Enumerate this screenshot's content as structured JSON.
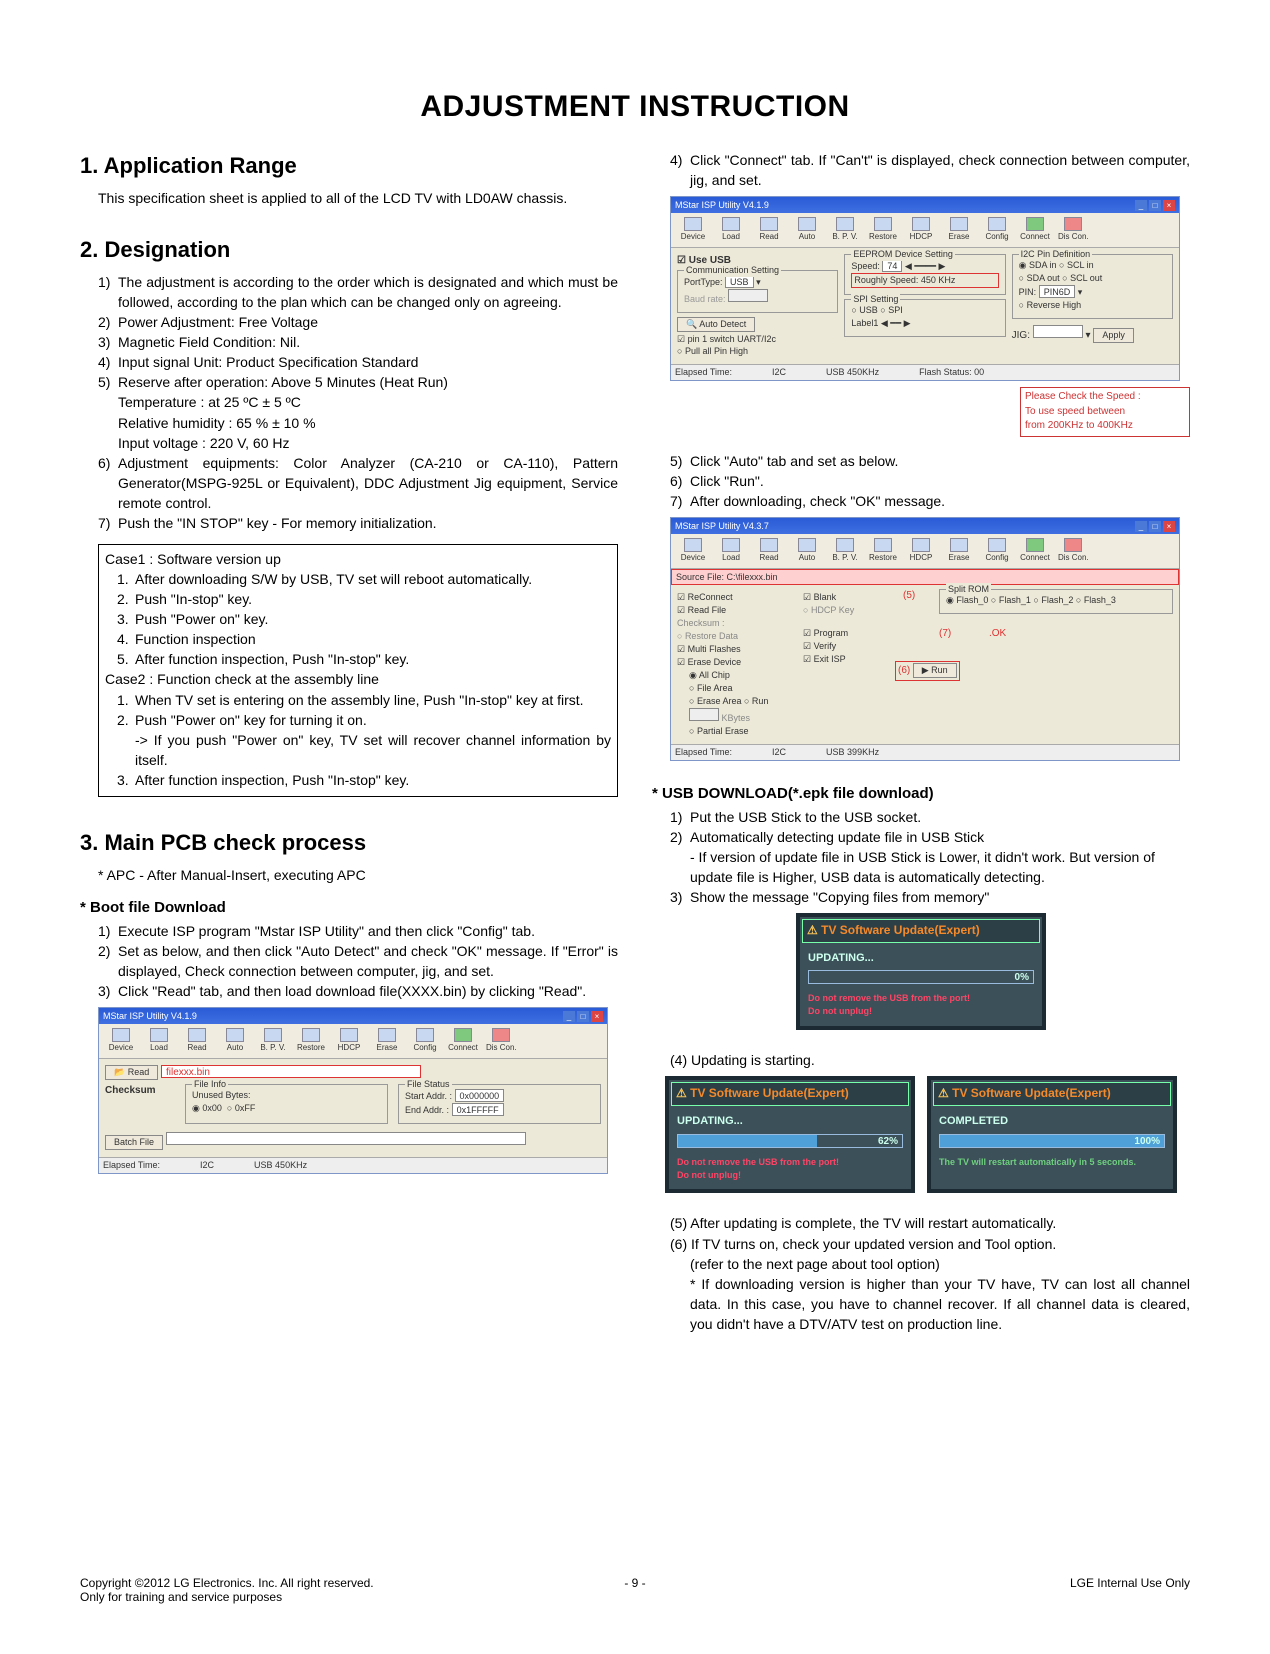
{
  "title": "ADJUSTMENT INSTRUCTION",
  "s1": {
    "heading": "1. Application Range",
    "body": "This specification sheet is applied to all of the LCD TV with LD0AW chassis."
  },
  "s2": {
    "heading": "2. Designation",
    "i1": "The adjustment is according to the order which is designated and which must be followed, according to the plan which can be changed only on agreeing.",
    "i2": "Power Adjustment: Free Voltage",
    "i3": "Magnetic Field Condition: Nil.",
    "i4": "Input signal Unit: Product Specification Standard",
    "i5": "Reserve after operation: Above 5 Minutes (Heat Run)",
    "i5a": "Temperature : at 25 ºC ± 5 ºC",
    "i5b": "Relative humidity : 65 % ± 10 %",
    "i5c": "Input voltage : 220 V, 60 Hz",
    "i6": "Adjustment equipments: Color Analyzer (CA-210 or CA-110), Pattern Generator(MSPG-925L or Equivalent), DDC Adjustment Jig equipment, Service remote control.",
    "i7": "Push the \"IN STOP\" key - For memory initialization.",
    "case1h": "Case1 : Software version up",
    "c1_1": "After downloading S/W by USB, TV set will reboot automatically.",
    "c1_2": "Push \"In-stop\" key.",
    "c1_3": "Push \"Power on\" key.",
    "c1_4": "Function inspection",
    "c1_5": "After function inspection, Push \"In-stop\" key.",
    "case2h": "Case2 : Function check at the assembly line",
    "c2_1": "When TV set is entering on the assembly line, Push \"In-stop\" key at first.",
    "c2_2": "Push \"Power on\" key for turning it on.",
    "c2_2a": "-> If you push \"Power on\" key, TV set will recover channel information by itself.",
    "c2_3": "After function inspection, Push \"In-stop\" key."
  },
  "s3": {
    "heading": "3. Main PCB check process",
    "apc": "* APC - After Manual-Insert, executing APC",
    "boot_h": "* Boot file Download",
    "b1": "Execute ISP program \"Mstar ISP Utility\" and then click \"Config\" tab.",
    "b2": "Set as below, and then click \"Auto Detect\" and check \"OK\" message. If \"Error\" is displayed, Check connection between computer, jig, and set.",
    "b3": "Click \"Read\" tab, and then load download file(XXXX.bin) by clicking \"Read\"."
  },
  "right": {
    "r4": "Click \"Connect\" tab. If \"Can't\" is displayed, check connection between computer, jig, and set.",
    "r5": "Click \"Auto\" tab and set as below.",
    "r6": "Click \"Run\".",
    "r7": "After downloading, check \"OK\" message.",
    "usb_h": "* USB DOWNLOAD(*.epk file download)",
    "u1": "Put the USB Stick to the USB socket.",
    "u2": "Automatically detecting update file in USB Stick",
    "u2a": "- If version of update file in USB Stick is Lower, it didn't work. But version of update file is Higher, USB data is automatically detecting.",
    "u3": "Show the message \"Copying files from memory\"",
    "u4": "(4) Updating is starting.",
    "u5": "(5) After updating is complete, the TV will restart automatically.",
    "u6": "(6) If TV turns on, check your updated version and Tool option.",
    "u6a": "(refer to the next page about tool option)",
    "u6b": "* If downloading version is higher than your TV have, TV can lost all channel data. In this case, you have to channel recover. If all channel data is cleared, you didn't have a DTV/ATV test on production line."
  },
  "shotA": {
    "title": "MStar ISP Utility V4.1.9",
    "tbtns": [
      "Device",
      "Load",
      "Read",
      "Auto",
      "B. P. V.",
      "Restore",
      "HDCP",
      "Erase",
      "Config",
      "Connect",
      "Dis Con."
    ],
    "read_btn": "Read",
    "filelabel": "filexxx.bin",
    "checksum": "Checksum",
    "file_info": "File Info",
    "unused": "Unused Bytes:",
    "opt00": "0x00",
    "optff": "0xFF",
    "file_status": "File Status",
    "startaddr": "Start Addr. :",
    "startv": "0x000000",
    "endaddr": "End Addr. :",
    "endv": "0x1FFFFF",
    "batch": "Batch File",
    "elapsed": "Elapsed Time:",
    "i2c": "I2C",
    "usb": "USB  450KHz"
  },
  "shotB": {
    "title": "MStar ISP Utility V4.1.9",
    "useusb": "Use USB",
    "comm": "Communication Setting",
    "porttype": "PortType:",
    "porttype_v": "USB",
    "baud": "Baud rate:",
    "autodetect": "Auto Detect",
    "pin1": "pin 1 switch UART/I2c",
    "pullpin": "Pull all Pin High",
    "eeprom": "EEPROM Device Setting",
    "speed": "Speed:",
    "speed_v": "74",
    "roughly": "Roughly Speed: 450 KHz",
    "spi": "SPI Setting",
    "usb2": "USB",
    "spi2": "SPI",
    "label1": "Label1",
    "i2cpin": "I2C Pin Definition",
    "sdain": "SDA in",
    "sclin": "SCL in",
    "sdaout": "SDA out",
    "sclout": "SCL out",
    "pin": "PIN:",
    "pin_v": "PIN6D",
    "revhigh": "Reverse High",
    "jig": "JIG:",
    "apply": "Apply",
    "elapsed": "Elapsed Time:",
    "i2c": "I2C",
    "usbstat": "USB  450KHz",
    "flashstat": "Flash Status: 00",
    "warn1": "Please Check the Speed :",
    "warn2": "To use speed between",
    "warn3": "from 200KHz   to 400KHz"
  },
  "shotC": {
    "title": "MStar ISP Utility V4.3.7",
    "tbtns": [
      "Device",
      "Load",
      "Read",
      "Auto",
      "B. P. V.",
      "Restore",
      "HDCP",
      "Erase",
      "Config",
      "Connect",
      "Dis Con."
    ],
    "src": "Source File: C:\\filexxx.bin",
    "reconnect": "ReConnect",
    "readfile": "Read File",
    "checksum": "Checksum :",
    "restoredata": "Restore Data",
    "multi": "Multi Flashes",
    "erasedev": "Erase Device",
    "allchip": "All Chip",
    "filearea": "File Area",
    "erasearea": "Erase Area",
    "partial": "Partial Erase",
    "blank": "Blank",
    "hdcpkey": "HDCP Key",
    "program": "Program",
    "verify": "Verify",
    "exitisp": "Exit ISP",
    "run": "Run",
    "run_n": "(6)",
    "five": "(5)",
    "seven": "(7)",
    "ok": ".OK",
    "splitgrp": "Split ROM",
    "flash0": "Flash_0",
    "flash1": "Flash_1",
    "flash2": "Flash_2",
    "flash3": "Flash_3",
    "kbytes": "KBytes",
    "elapsed": "Elapsed Time:",
    "i2c": "I2C",
    "usbstat": "USB  399KHz"
  },
  "tv1": {
    "hdr": "TV Software Update(Expert)",
    "status": "UPDATING...",
    "pct": "0%",
    "warn1": "Do not remove the USB from the port!",
    "warn2": "Do not unplug!"
  },
  "tv2": {
    "hdr": "TV Software Update(Expert)",
    "status": "UPDATING...",
    "pct": "62%",
    "warn1": "Do not remove the USB from the port!",
    "warn2": "Do not unplug!"
  },
  "tv3": {
    "hdr": "TV Software Update(Expert)",
    "status": "COMPLETED",
    "pct": "100%",
    "warn1": "The TV will restart automatically in 5 seconds."
  },
  "footer": {
    "left1": "Copyright ©2012 LG Electronics. Inc. All right reserved.",
    "left2": "Only for training and service purposes",
    "mid": "- 9 -",
    "right": "LGE Internal Use Only"
  }
}
